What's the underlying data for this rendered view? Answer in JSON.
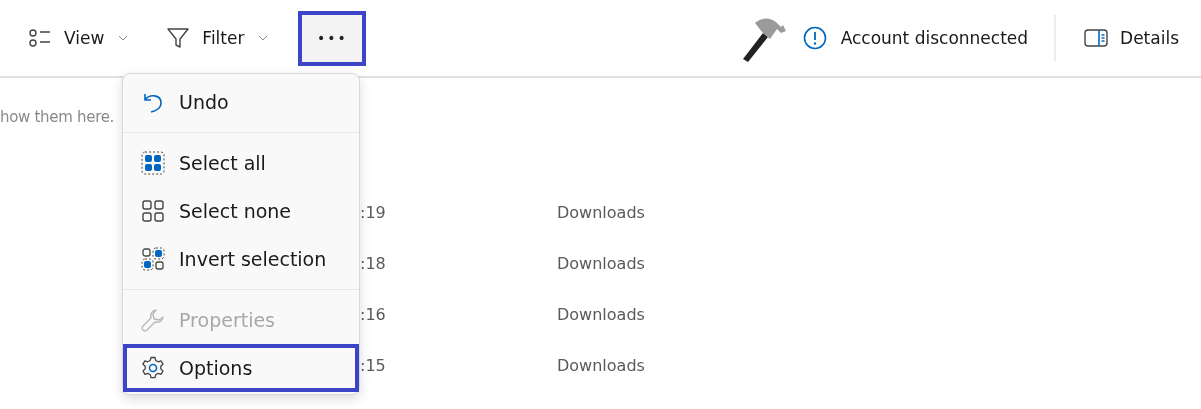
{
  "toolbar": {
    "view": {
      "label": "View"
    },
    "filter": {
      "label": "Filter"
    },
    "more": {
      "label": "•••",
      "highlighted": true
    },
    "account_status": "Account disconnected",
    "details": {
      "label": "Details"
    }
  },
  "content": {
    "message": "how them here.",
    "rows": [
      {
        "time": ":19",
        "location": "Downloads"
      },
      {
        "time": ":18",
        "location": "Downloads"
      },
      {
        "time": ":16",
        "location": "Downloads"
      },
      {
        "time": ":15",
        "location": "Downloads"
      }
    ]
  },
  "menu": {
    "groups": [
      [
        {
          "kind": "undo",
          "label": "Undo",
          "disabled": false,
          "highlighted": false
        }
      ],
      [
        {
          "kind": "select-all",
          "label": "Select all",
          "disabled": false,
          "highlighted": false
        },
        {
          "kind": "select-none",
          "label": "Select none",
          "disabled": false,
          "highlighted": false
        },
        {
          "kind": "invert",
          "label": "Invert selection",
          "disabled": false,
          "highlighted": false
        }
      ],
      [
        {
          "kind": "properties",
          "label": "Properties",
          "disabled": true,
          "highlighted": false
        },
        {
          "kind": "options",
          "label": "Options",
          "disabled": false,
          "highlighted": true
        }
      ]
    ]
  }
}
